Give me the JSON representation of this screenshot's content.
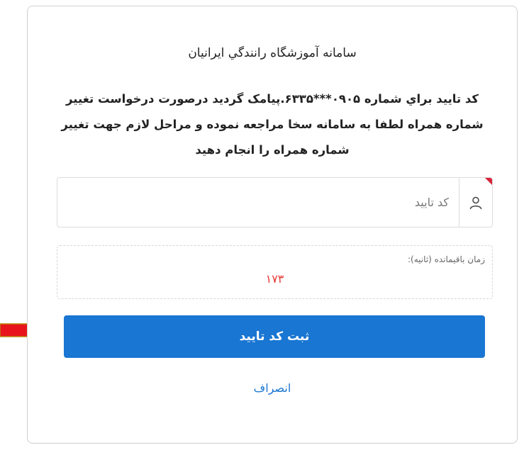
{
  "colors": {
    "accent": "#1976d2",
    "timer": "#e53935",
    "arrow": "#e8141b",
    "required": "#d9233a"
  },
  "card": {
    "title": "سامانه آموزشگاه رانندگي ايرانيان",
    "message": "کد تاييد براي شماره ۰۹۰۵***۶۳۳۵.پيامک گرديد درصورت درخواست تغيير شماره همراه لطفا به سامانه سخا مراجعه نموده و مراحل لازم جهت تغيير شماره همراه را انجام دهيد"
  },
  "code_input": {
    "placeholder": "کد تایید",
    "value": "",
    "icon": "user-icon"
  },
  "timer": {
    "label": "زمان باقیمانده (ثانیه):",
    "seconds": "۱۷۳"
  },
  "actions": {
    "submit_label": "ثبت کد تایید",
    "cancel_label": "انصراف"
  },
  "annotation": {
    "icon": "red-arrow-right-icon"
  }
}
